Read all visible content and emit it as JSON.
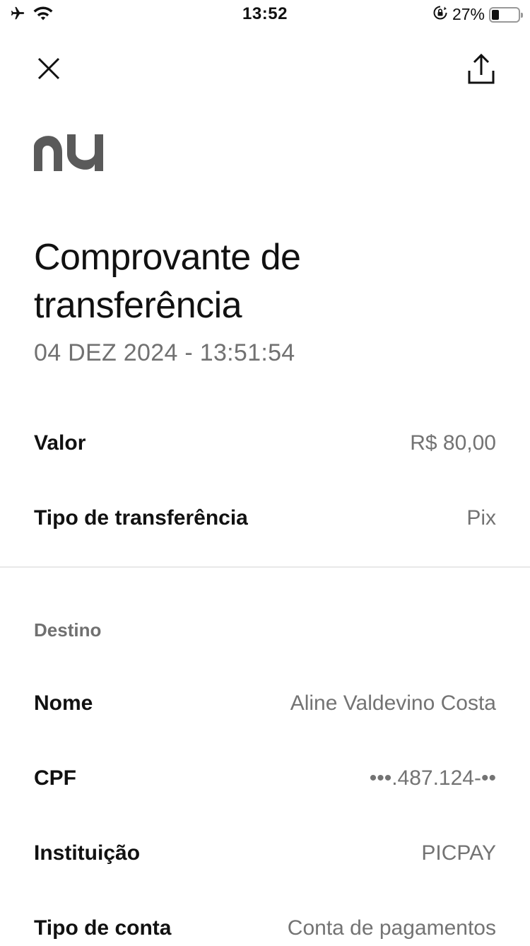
{
  "status_bar": {
    "time": "13:52",
    "battery_percent_text": "27%",
    "battery_level": 0.27,
    "icons": [
      "airplane-icon",
      "wifi-icon",
      "orientation-lock-icon",
      "battery-icon"
    ]
  },
  "header": {
    "close_icon": "close-icon",
    "share_icon": "share-icon",
    "logo_text": "nu"
  },
  "receipt": {
    "title": "Comprovante de transferência",
    "datetime": "04 DEZ 2024 - 13:51:54"
  },
  "summary": [
    {
      "label": "Valor",
      "value": "R$ 80,00"
    },
    {
      "label": "Tipo de transferência",
      "value": "Pix"
    }
  ],
  "destination": {
    "section_label": "Destino",
    "fields": [
      {
        "label": "Nome",
        "value": "Aline Valdevino Costa"
      },
      {
        "label": "CPF",
        "value": "•••.487.124-••"
      },
      {
        "label": "Instituição",
        "value": "PICPAY"
      },
      {
        "label": "Tipo de conta",
        "value": "Conta de pagamentos"
      }
    ]
  },
  "colors": {
    "text_primary": "#111111",
    "text_secondary": "#737373",
    "logo": "#5a5a5a",
    "divider": "#e8e8e8",
    "background": "#ffffff"
  }
}
